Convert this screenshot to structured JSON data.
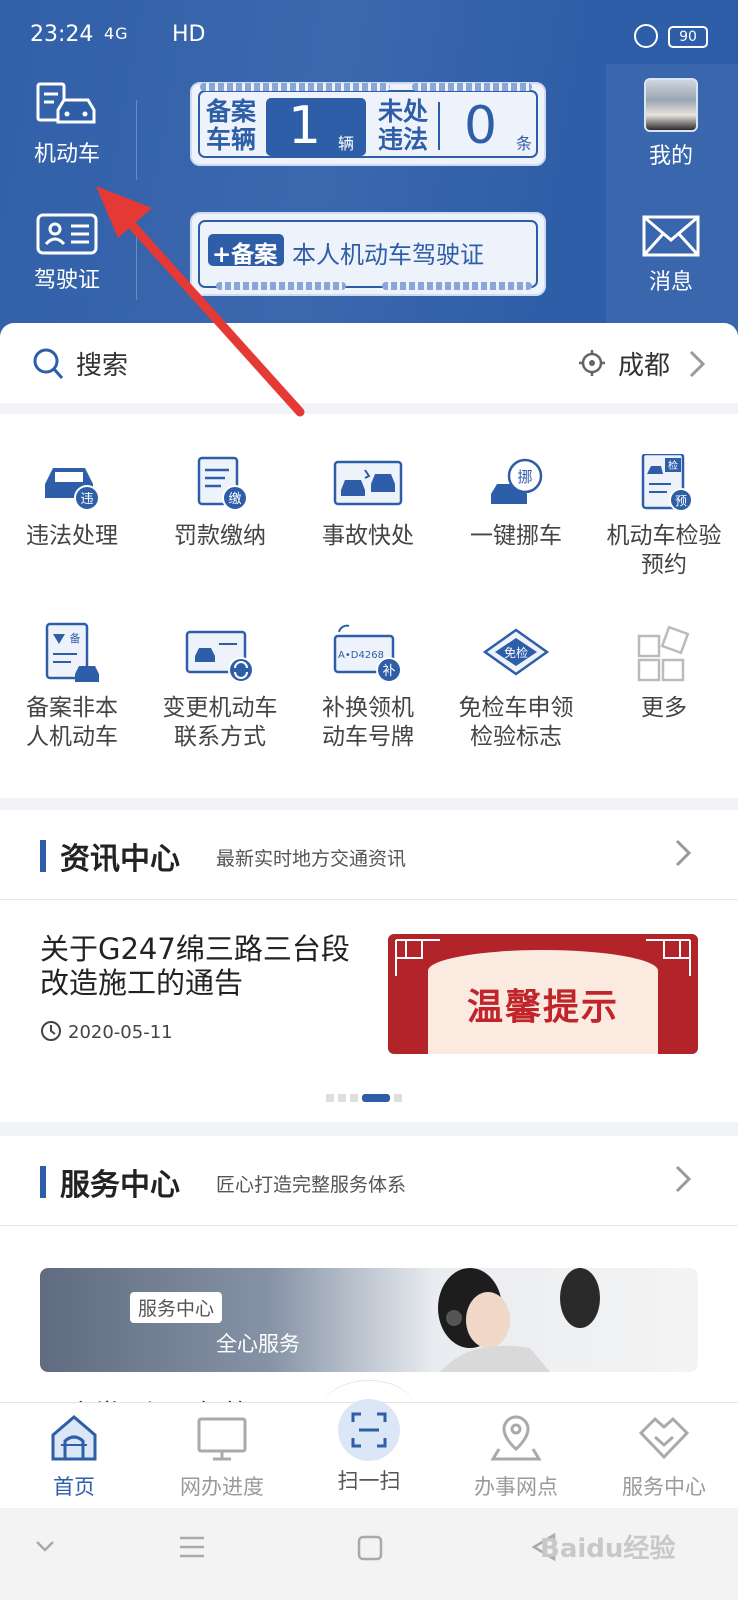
{
  "status_bar": {
    "time": "23:24",
    "signal": "4G",
    "network": "HD",
    "battery": "90"
  },
  "header": {
    "vehicle_tile": "机动车",
    "license_tile": "驾驶证",
    "profile_label": "我的",
    "messages_label": "消息",
    "plate_registered_label_1": "备案",
    "plate_registered_label_2": "车辆",
    "registered_count": "1",
    "registered_unit": "辆",
    "plate_violations_label_1": "未处",
    "plate_violations_label_2": "违法",
    "violations_count": "0",
    "violations_unit": "条",
    "add_license_badge": "+备案",
    "add_license_text": "本人机动车驾驶证"
  },
  "search": {
    "placeholder": "搜索",
    "city": "成都"
  },
  "services": [
    {
      "label": "违法处理",
      "badge": "违"
    },
    {
      "label": "罚款缴纳",
      "badge": "缴"
    },
    {
      "label": "事故快处"
    },
    {
      "label": "一键挪车",
      "badge": "挪"
    },
    {
      "label": "机动车检验预约",
      "badge": "检",
      "badge2": "预"
    },
    {
      "label": "备案非本人机动车",
      "badge": "备"
    },
    {
      "label": "变更机动车联系方式"
    },
    {
      "label": "补换领机动车号牌",
      "badge": "补",
      "plate": "A•D4268"
    },
    {
      "label": "免检车申领检验标志",
      "badge": "免检"
    },
    {
      "label": "更多"
    }
  ],
  "news": {
    "title": "资讯中心",
    "subtitle": "最新实时地方交通资讯",
    "article_title": "关于G247绵三路三台段改造施工的通告",
    "date": "2020-05-11",
    "image_text": "温馨提示"
  },
  "service_center": {
    "title": "服务中心",
    "subtitle": "匠心打造完整服务体系",
    "banner_tag": "服务中心",
    "banner_text": "全心服务",
    "faq_peek": "用户常见问题解答"
  },
  "bottom_nav": [
    {
      "label": "首页"
    },
    {
      "label": "网办进度"
    },
    {
      "label": "扫一扫"
    },
    {
      "label": "办事网点"
    },
    {
      "label": "服务中心"
    }
  ],
  "watermark": "Baidu经验",
  "colors": {
    "primary": "#2f5ea8",
    "annotation_arrow": "#e53935",
    "news_red": "#b3242a"
  }
}
